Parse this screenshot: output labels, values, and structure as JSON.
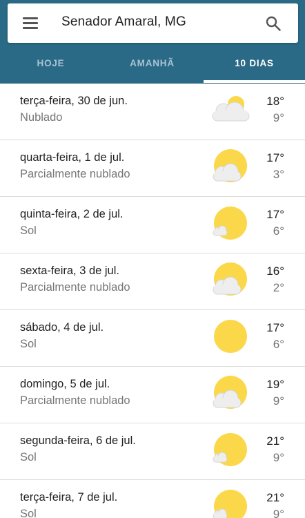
{
  "header": {
    "location": "Senador Amaral, MG",
    "tabs": [
      {
        "label": "HOJE",
        "active": false
      },
      {
        "label": "AMANHÃ",
        "active": false
      },
      {
        "label": "10 DIAS",
        "active": true
      }
    ]
  },
  "colors": {
    "header_bg": "#2b6a86",
    "sun": "#fbd84a",
    "cloud": "#eeeeee"
  },
  "forecast": [
    {
      "date": "terça-feira, 30 de jun.",
      "condition": "Nublado",
      "high": "18°",
      "low": "9°",
      "icon": "cloudy-icon"
    },
    {
      "date": "quarta-feira, 1 de jul.",
      "condition": "Parcialmente nublado",
      "high": "17°",
      "low": "3°",
      "icon": "partly-cloudy-icon"
    },
    {
      "date": "quinta-feira, 2 de jul.",
      "condition": "Sol",
      "high": "17°",
      "low": "6°",
      "icon": "sunny-icon"
    },
    {
      "date": "sexta-feira, 3 de jul.",
      "condition": "Parcialmente nublado",
      "high": "16°",
      "low": "2°",
      "icon": "partly-cloudy-icon"
    },
    {
      "date": "sábado, 4 de jul.",
      "condition": "Sol",
      "high": "17°",
      "low": "6°",
      "icon": "sun-icon"
    },
    {
      "date": "domingo, 5 de jul.",
      "condition": "Parcialmente nublado",
      "high": "19°",
      "low": "9°",
      "icon": "partly-cloudy-icon"
    },
    {
      "date": "segunda-feira, 6 de jul.",
      "condition": "Sol",
      "high": "21°",
      "low": "9°",
      "icon": "sunny-icon"
    },
    {
      "date": "terça-feira, 7 de jul.",
      "condition": "Sol",
      "high": "21°",
      "low": "9°",
      "icon": "sunny-icon"
    }
  ]
}
